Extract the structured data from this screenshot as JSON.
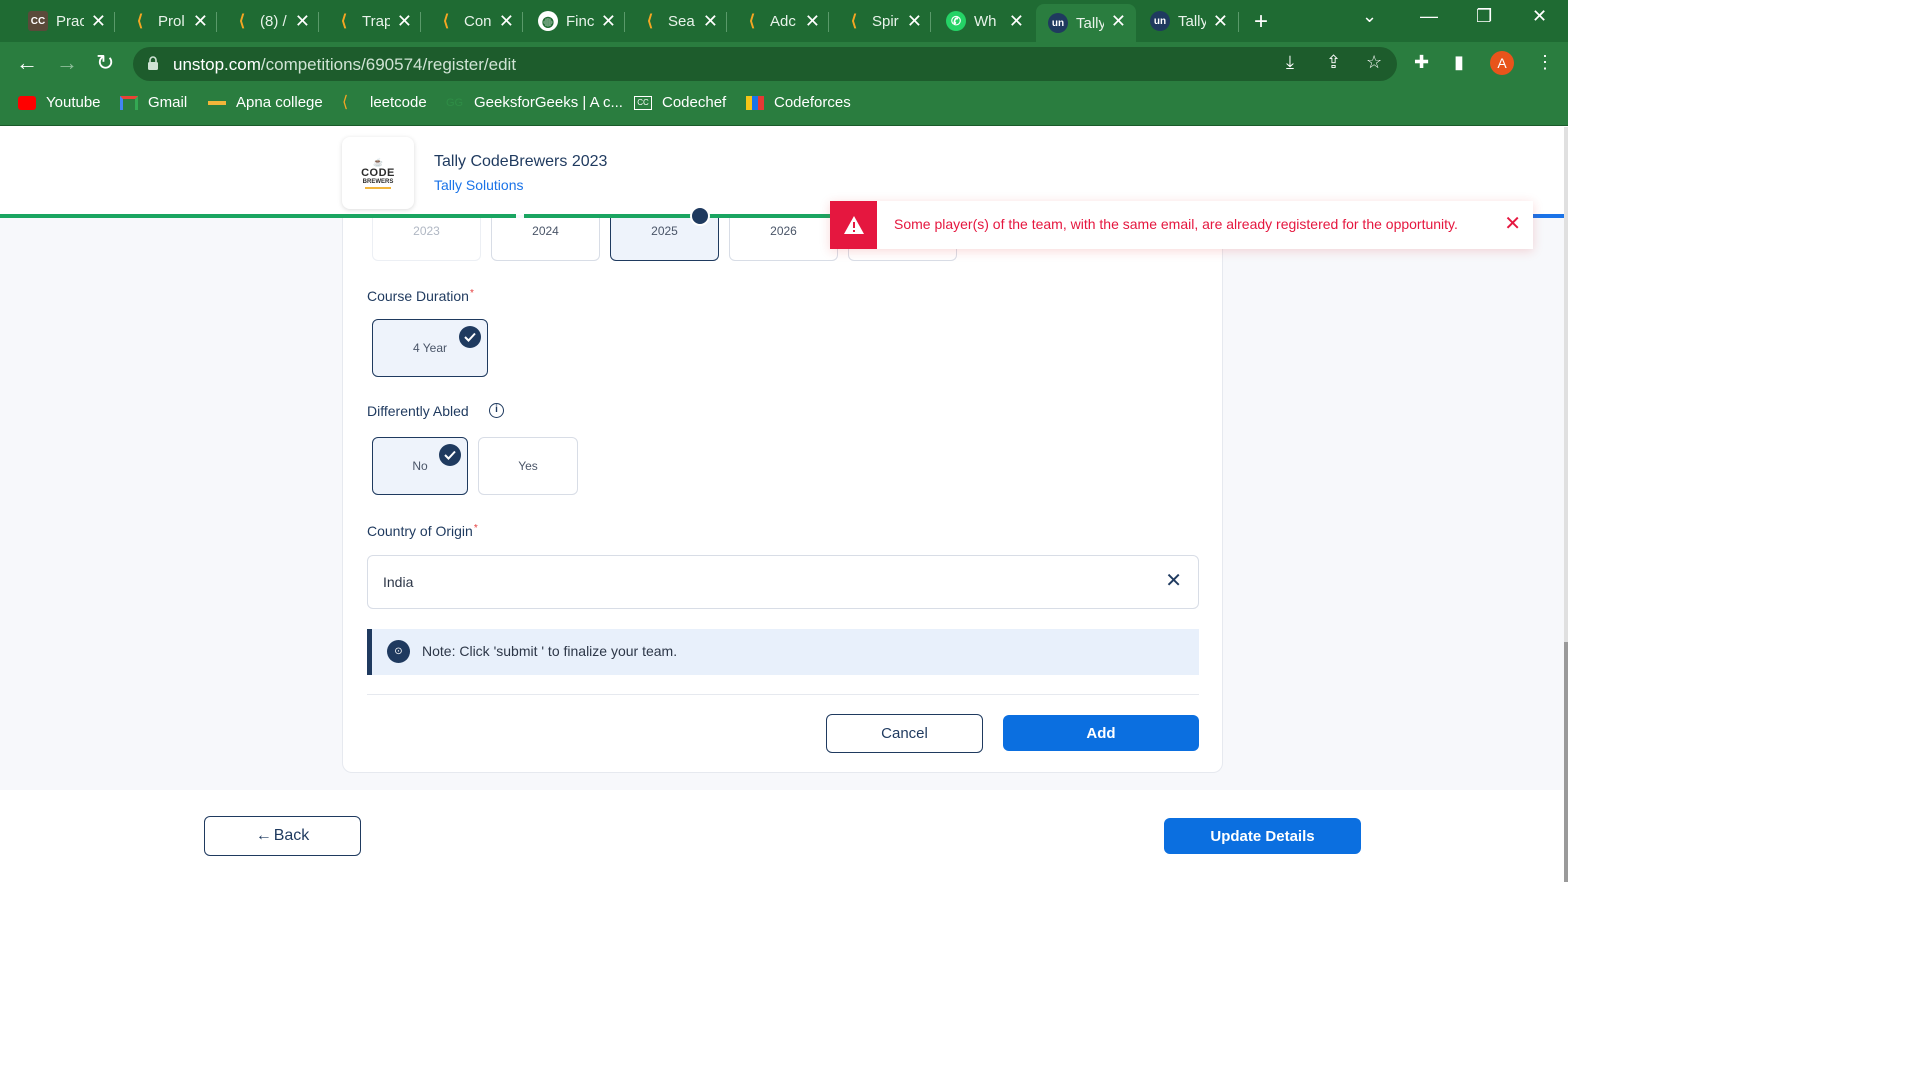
{
  "browser": {
    "tabs": [
      {
        "title": "Prac",
        "icon": "codechef-icon"
      },
      {
        "title": "Prol",
        "icon": "leetcode-icon"
      },
      {
        "title": "(8) /",
        "icon": "leetcode-icon"
      },
      {
        "title": "Trap",
        "icon": "leetcode-icon"
      },
      {
        "title": "Con",
        "icon": "leetcode-icon"
      },
      {
        "title": "Finc",
        "icon": "globe-icon"
      },
      {
        "title": "Sea",
        "icon": "leetcode-icon"
      },
      {
        "title": "Adc",
        "icon": "leetcode-icon"
      },
      {
        "title": "Spir",
        "icon": "leetcode-icon"
      },
      {
        "title": "Wh",
        "icon": "whatsapp-icon"
      },
      {
        "title": "Tally",
        "icon": "unstop-icon",
        "active": true
      },
      {
        "title": "Tally",
        "icon": "unstop-icon"
      }
    ],
    "url_domain": "unstop.com",
    "url_path": "/competitions/690574/register/edit",
    "profile_initial": "A",
    "bookmarks": [
      "Youtube",
      "Gmail",
      "Apna college",
      "leetcode",
      "GeeksforGeeks | A c...",
      "Codechef",
      "Codeforces"
    ]
  },
  "header": {
    "event_title": "Tally CodeBrewers 2023",
    "organizer": "Tally Solutions",
    "logo_text": "CODE",
    "logo_subtext": "BREWERS"
  },
  "form": {
    "years": [
      "2023",
      "2024",
      "2025",
      "2026",
      ""
    ],
    "selected_year": "2025",
    "course_duration_label": "Course Duration",
    "course_duration_value": "4 Year",
    "differently_abled_label": "Differently Abled",
    "differently_abled_options": [
      "No",
      "Yes"
    ],
    "differently_abled_selected": "No",
    "country_label": "Country of Origin",
    "country_value": "India",
    "note": "Note: Click 'submit ' to finalize your team.",
    "cancel_label": "Cancel",
    "add_label": "Add"
  },
  "footer": {
    "back_label": "Back",
    "update_label": "Update Details"
  },
  "toast": {
    "message": "Some player(s) of the team, with the same email, are already registered for the opportunity."
  },
  "colors": {
    "chrome_green": "#2a7d3f",
    "navy": "#1f3a5f",
    "primary_blue": "#0b6fe0",
    "error_red": "#e5173f",
    "progress_green": "#1aa561"
  }
}
